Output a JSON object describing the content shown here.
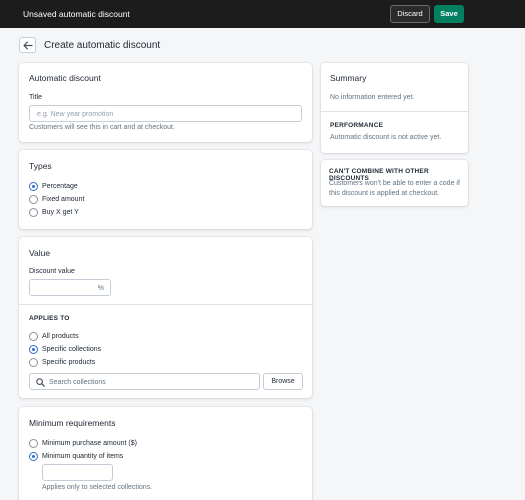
{
  "topbar": {
    "title": "Unsaved automatic discount",
    "discard_label": "Discard",
    "save_label": "Save",
    "save_color": "#008060"
  },
  "page": {
    "title": "Create automatic discount"
  },
  "automatic_discount": {
    "heading": "Automatic discount",
    "title_label": "Title",
    "title_placeholder": "e.g. New year promotion",
    "title_help": "Customers will see this in cart and at checkout."
  },
  "types": {
    "heading": "Types",
    "options": [
      {
        "label": "Percentage",
        "selected": true
      },
      {
        "label": "Fixed amount",
        "selected": false
      },
      {
        "label": "Buy X get Y",
        "selected": false
      }
    ]
  },
  "value": {
    "heading": "Value",
    "discount_label": "Discount value",
    "discount_suffix": "%",
    "applies_heading": "APPLIES TO",
    "applies_options": [
      {
        "label": "All products",
        "selected": false
      },
      {
        "label": "Specific collections",
        "selected": true
      },
      {
        "label": "Specific products",
        "selected": false
      }
    ],
    "search_placeholder": "Search collections",
    "browse_label": "Browse"
  },
  "minimum": {
    "heading": "Minimum requirements",
    "options": [
      {
        "label": "Minimum purchase amount ($)",
        "selected": false
      },
      {
        "label": "Minimum quantity of items",
        "selected": true
      }
    ],
    "help": "Applies only to selected collections."
  },
  "summary": {
    "heading": "Summary",
    "empty_text": "No information entered yet.",
    "performance_heading": "PERFORMANCE",
    "performance_text": "Automatic discount is not active yet."
  },
  "combine": {
    "heading": "CAN'T COMBINE WITH OTHER DISCOUNTS",
    "text_line1": "Customers won't be able to enter a code if",
    "text_line2": "this discount is applied at checkout."
  }
}
